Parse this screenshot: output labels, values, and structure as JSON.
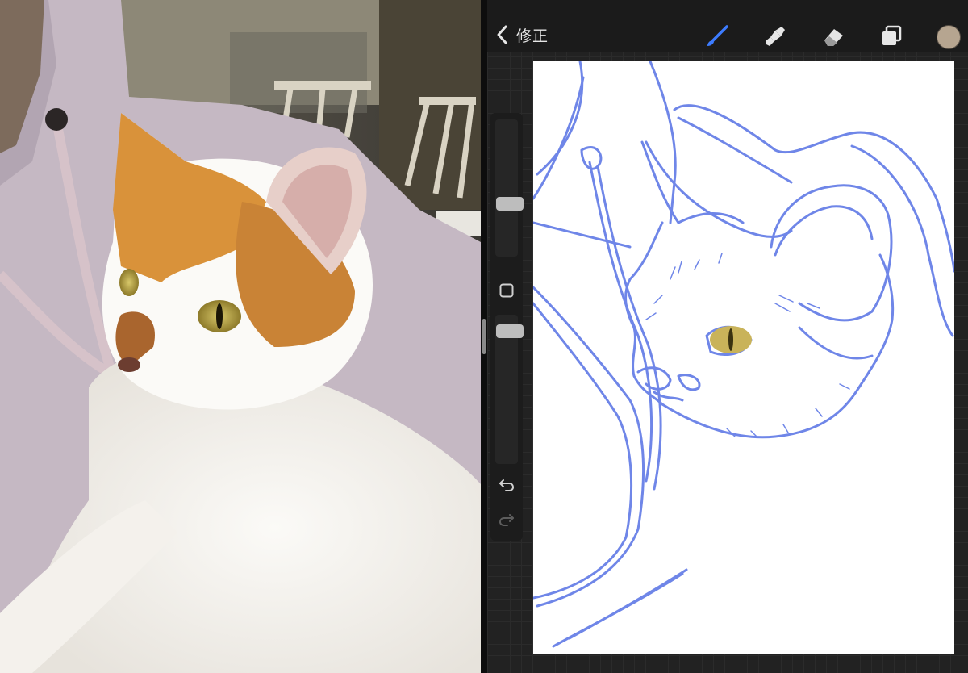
{
  "app": {
    "back_label": "修正",
    "tools": [
      {
        "name": "brush-icon",
        "color": "#3d7cff"
      },
      {
        "name": "smudge-icon",
        "color": "#e6e6e6"
      },
      {
        "name": "eraser-icon",
        "color": "#e6e6e6"
      },
      {
        "name": "layers-icon",
        "color": "#e6e6e6"
      }
    ],
    "current_color": "#b6a590",
    "sidebar": {
      "buttons": [
        "undo-icon",
        "redo-icon",
        "modify-square-icon"
      ]
    }
  },
  "colors": {
    "stroke": "#6f86e8",
    "app_background": "#222222",
    "toolbar": "#1b1b1b",
    "canvas": "#ffffff"
  }
}
